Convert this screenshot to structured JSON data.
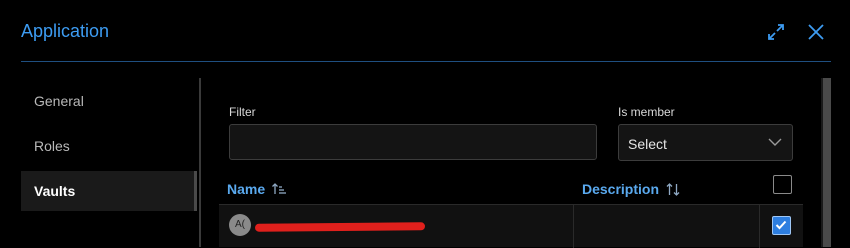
{
  "dialog": {
    "title": "Application",
    "icons": {
      "expand": "expand-icon",
      "close": "close-icon"
    }
  },
  "sidebar": {
    "items": [
      {
        "label": "General",
        "active": false
      },
      {
        "label": "Roles",
        "active": false
      },
      {
        "label": "Vaults",
        "active": true
      }
    ]
  },
  "filters": {
    "filter_label": "Filter",
    "filter_value": "",
    "member_label": "Is member",
    "member_selected": "Select"
  },
  "table": {
    "columns": [
      {
        "label": "Name",
        "sort_icon": "sort-ascending-icon"
      },
      {
        "label": "Description",
        "sort_icon": "sort-icon"
      }
    ],
    "header_checked": false,
    "rows": [
      {
        "avatar": "A(",
        "name": "",
        "description": "",
        "checked": true,
        "redacted": true
      }
    ]
  },
  "colors": {
    "accent": "#3d9cf2",
    "header_text": "#5aa9ee",
    "checkbox": "#2d7ee0",
    "redaction": "#e0201c"
  }
}
